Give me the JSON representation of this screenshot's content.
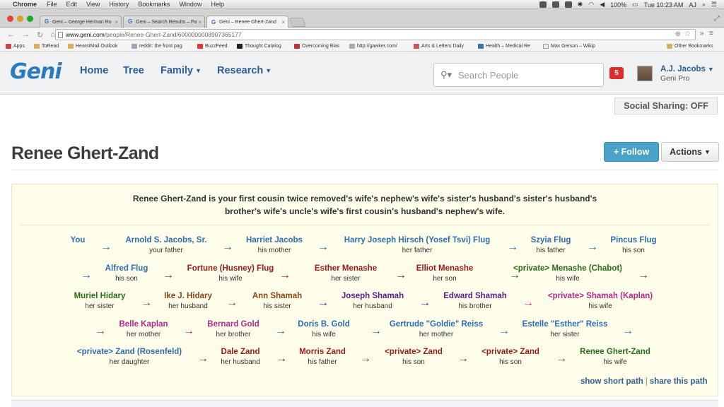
{
  "menubar": {
    "app": "Chrome",
    "items": [
      "File",
      "Edit",
      "View",
      "History",
      "Bookmarks",
      "Window",
      "Help"
    ],
    "battery": "100%",
    "clock": "Tue 10:23 AM",
    "user": "AJ"
  },
  "tabs": [
    {
      "label": "Geni – George Herman Ru"
    },
    {
      "label": "Geni – Search Results – Pa"
    },
    {
      "label": "Geni – Renee Ghert-Zand"
    }
  ],
  "address": {
    "host": "www.geni.com",
    "path": "/people/Renee-Ghert-Zand/6000000008907365177"
  },
  "bookmarks": {
    "items": [
      "Apps",
      "ToRead",
      "HearstMail Outlook",
      "reddit: the front pag",
      "BuzzFeed",
      "Thought Catalog",
      "Overcoming Bias",
      "http://gawker.com/",
      "Arts & Letters Daily",
      "Health – Medical Re",
      "Max Gerson – Wikip"
    ],
    "other": "Other Bookmarks"
  },
  "header": {
    "logo": "Geni",
    "nav": [
      "Home",
      "Tree",
      "Family",
      "Research"
    ],
    "search_placeholder": "Search People",
    "notifications": "5",
    "user_name": "A.J. Jacobs",
    "user_plan": "Geni Pro"
  },
  "social_sharing": "Social Sharing: OFF",
  "page": {
    "title": "Renee Ghert-Zand",
    "follow": "+ Follow",
    "actions": "Actions"
  },
  "relationship": {
    "line1": "Renee Ghert-Zand is your first cousin twice removed's wife's nephew's wife's sister's husband's sister's husband's",
    "line2": "brother's wife's uncle's wife's first cousin's husband's nephew's wife.",
    "path": [
      {
        "name": "You",
        "rel": ""
      },
      {
        "name": "Arnold S. Jacobs, Sr.",
        "rel": "your father"
      },
      {
        "name": "Harriet Jacobs",
        "rel": "his mother"
      },
      {
        "name": "Harry Joseph Hirsch (Yosef Tsvi) Flug",
        "rel": "her father"
      },
      {
        "name": "Szyia Flug",
        "rel": "his father"
      },
      {
        "name": "Pincus Flug",
        "rel": "his son"
      },
      {
        "name": "Alfred Flug",
        "rel": "his son"
      },
      {
        "name": "Fortune (Husney) Flug",
        "rel": "his wife"
      },
      {
        "name": "Esther Menashe",
        "rel": "her sister"
      },
      {
        "name": "Elliot Menashe",
        "rel": "her son"
      },
      {
        "name": "<private> Menashe (Chabot)",
        "rel": "his wife"
      },
      {
        "name": "Muriel Hidary",
        "rel": "her sister"
      },
      {
        "name": "Ike J. Hidary",
        "rel": "her husband"
      },
      {
        "name": "Ann Shamah",
        "rel": "his sister"
      },
      {
        "name": "Joseph Shamah",
        "rel": "her husband"
      },
      {
        "name": "Edward Shamah",
        "rel": "his brother"
      },
      {
        "name": "<private> Shamah (Kaplan)",
        "rel": "his wife"
      },
      {
        "name": "Belle Kaplan",
        "rel": "her mother"
      },
      {
        "name": "Bernard Gold",
        "rel": "her brother"
      },
      {
        "name": "Doris B. Gold",
        "rel": "his wife"
      },
      {
        "name": "Gertrude \"Goldie\" Reiss",
        "rel": "her mother"
      },
      {
        "name": "Estelle \"Esther\" Reiss",
        "rel": "her sister"
      },
      {
        "name": "<private> Zand (Rosenfeld)",
        "rel": "her daughter"
      },
      {
        "name": "Dale Zand",
        "rel": "her husband"
      },
      {
        "name": "Morris Zand",
        "rel": "his father"
      },
      {
        "name": "<private> Zand",
        "rel": "his son"
      },
      {
        "name": "<private> Zand",
        "rel": "his son"
      },
      {
        "name": "Renee Ghert-Zand",
        "rel": "his wife"
      }
    ],
    "colors": {
      "blue": "#2d6db5",
      "red": "#9b1b1b",
      "green": "#2a6e1a",
      "brown": "#8b4513",
      "purple": "#5a1e8c",
      "magenta": "#b5298a"
    },
    "show_short_path": "show short path",
    "share_this_path": "share this path"
  }
}
